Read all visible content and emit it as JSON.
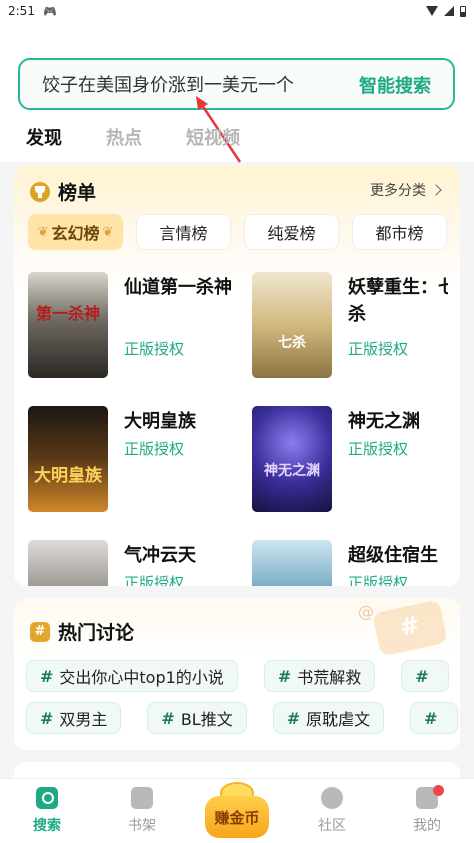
{
  "status_bar": {
    "time": "2:51",
    "game_icon": "gamepad-icon"
  },
  "search": {
    "query": "饺子在美国身价涨到一美元一个",
    "button": "智能搜索"
  },
  "tabs": [
    {
      "label": "发现",
      "active": true
    },
    {
      "label": "热点",
      "active": false
    },
    {
      "label": "短视频",
      "active": false
    }
  ],
  "rank": {
    "title": "榜单",
    "more": "更多分类",
    "categories": [
      "玄幻榜",
      "言情榜",
      "纯爱榜",
      "都市榜"
    ],
    "books": [
      {
        "title": "仙道第一杀神",
        "badge": "正版授权",
        "cover_text": "第一杀神"
      },
      {
        "title": "妖孽重生：七杀",
        "badge": "正版授权",
        "cover_text": "七杀"
      },
      {
        "title": "大明皇族",
        "badge": "正版授权",
        "cover_text": "大明皇族"
      },
      {
        "title": "神无之渊",
        "badge": "正版授权",
        "cover_text": "神无之渊"
      },
      {
        "title": "气冲云天",
        "badge": "正版授权",
        "cover_text": ""
      },
      {
        "title": "超级住宿生",
        "badge": "正版授权",
        "cover_text": ""
      }
    ]
  },
  "hot": {
    "title": "热门讨论",
    "row1": [
      "交出你心中top1的小说",
      "书荒解救",
      "#"
    ],
    "row2": [
      "双男主",
      "BL推文",
      "原耽虐文",
      "#"
    ]
  },
  "nav": {
    "search": "搜索",
    "shelf": "书架",
    "earn": "赚金币",
    "community": "社区",
    "mine": "我的"
  },
  "colors": {
    "accent": "#1faa86",
    "rank_active": "#ffe3a8"
  }
}
